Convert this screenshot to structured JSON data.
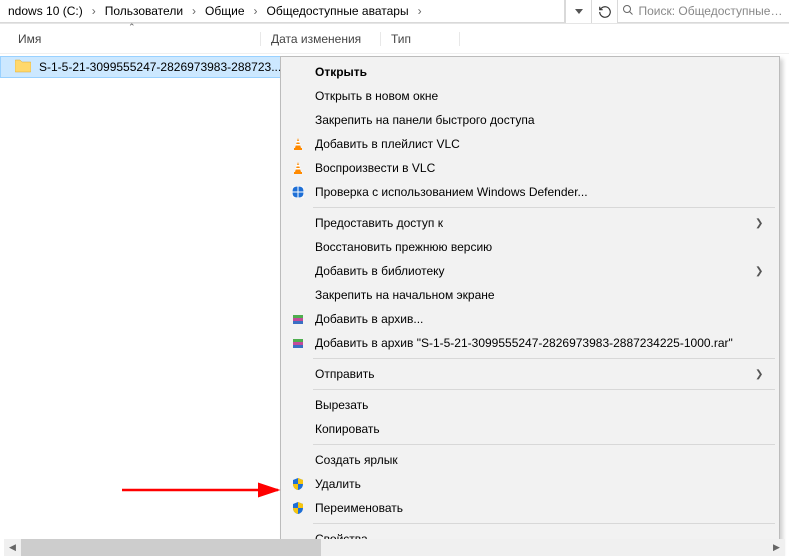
{
  "breadcrumb": {
    "items": [
      "ndows 10 (C:)",
      "Пользователи",
      "Общие",
      "Общедоступные аватары"
    ]
  },
  "search": {
    "placeholder": "Поиск: Общедоступные ава..."
  },
  "columns": {
    "name": "Имя",
    "date": "Дата изменения",
    "type": "Тип"
  },
  "file": {
    "name": "S-1-5-21-3099555247-2826973983-288723..."
  },
  "menu": {
    "open": "Открыть",
    "open_new": "Открыть в новом окне",
    "pin_quick": "Закрепить на панели быстрого доступа",
    "vlc_add": "Добавить в плейлист VLC",
    "vlc_play": "Воспроизвести в VLC",
    "defender": "Проверка с использованием Windows Defender...",
    "share": "Предоставить доступ к",
    "restore": "Восстановить прежнюю версию",
    "library": "Добавить в библиотеку",
    "pin_start": "Закрепить на начальном экране",
    "rar_add": "Добавить в архив...",
    "rar_named": "Добавить в архив \"S-1-5-21-3099555247-2826973983-2887234225-1000.rar\"",
    "send": "Отправить",
    "cut": "Вырезать",
    "copy": "Копировать",
    "shortcut": "Создать ярлык",
    "delete": "Удалить",
    "rename": "Переименовать",
    "properties": "Свойства"
  }
}
